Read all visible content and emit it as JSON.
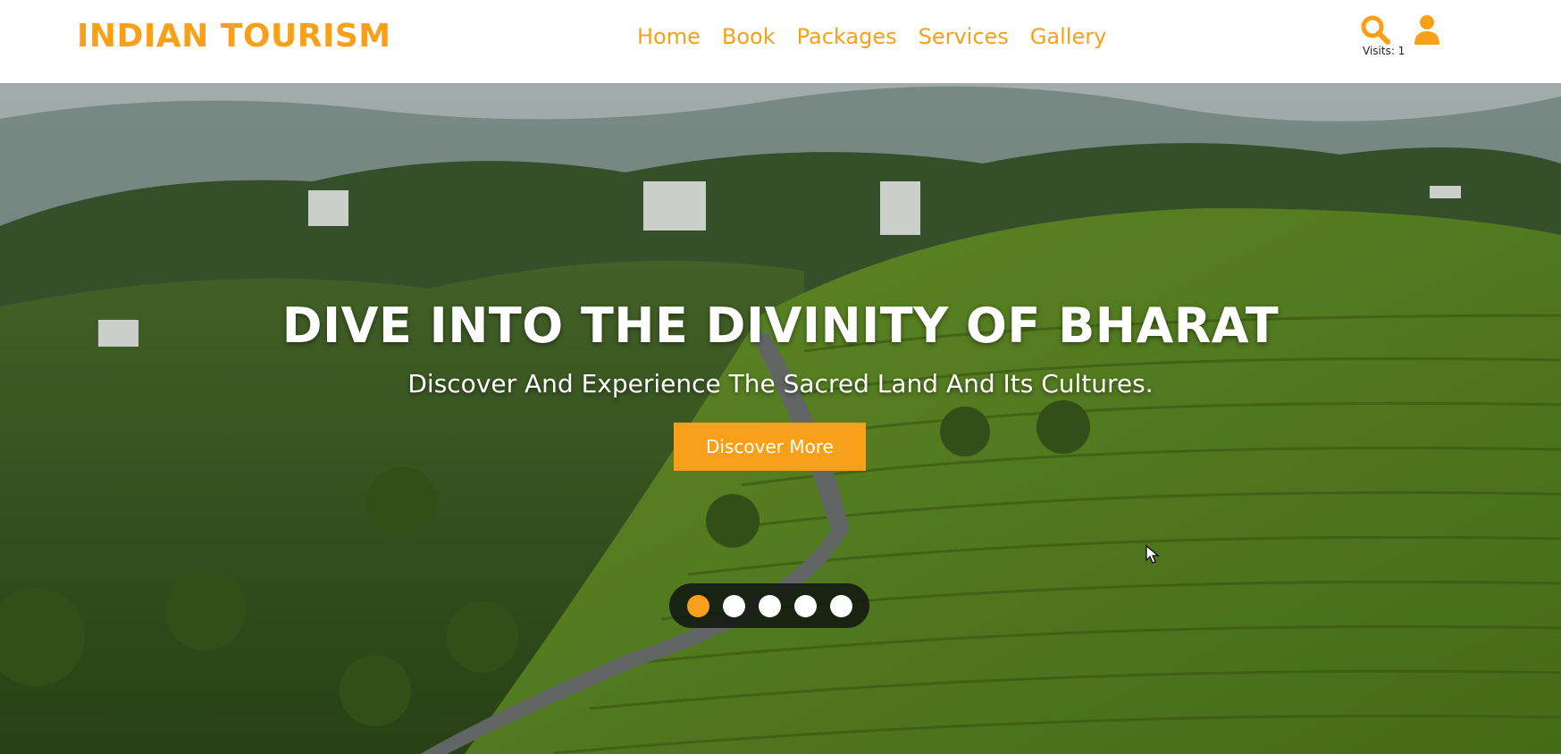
{
  "header": {
    "logo": "INDIAN TOURISM",
    "nav": [
      "Home",
      "Book",
      "Packages",
      "Services",
      "Gallery"
    ],
    "icons": [
      "search-icon",
      "user-icon"
    ],
    "visits": "Visits: 1"
  },
  "hero": {
    "title": "DIVE INTO THE DIVINITY OF BHARAT",
    "subtitle": "Discover And Experience The Sacred Land And Its Cultures.",
    "cta": "Discover More",
    "slides": 5,
    "active_slide": 1
  },
  "colors": {
    "accent": "#f9a01b",
    "header_bg": "#ffffff",
    "dot_inactive": "#ffffff",
    "dots_bg": "#0f140f"
  }
}
